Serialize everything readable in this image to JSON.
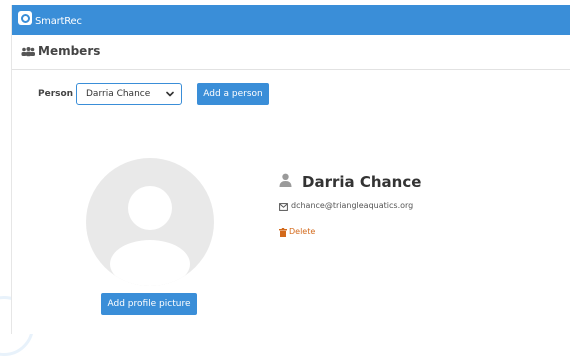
{
  "app": {
    "brand_small": "",
    "brand": "SmartRec",
    "accent": "#3a8ed8"
  },
  "header": {
    "icon": "members-icon",
    "title": "Members"
  },
  "person_select": {
    "label": "Person",
    "value": "Darria Chance"
  },
  "actions": {
    "add_person": "Add a person",
    "add_picture": "Add profile picture"
  },
  "profile": {
    "name": "Darria Chance",
    "email": "dchance@triangleaquatics.org",
    "delete_label": "Delete",
    "delete_color": "#d3691b"
  }
}
